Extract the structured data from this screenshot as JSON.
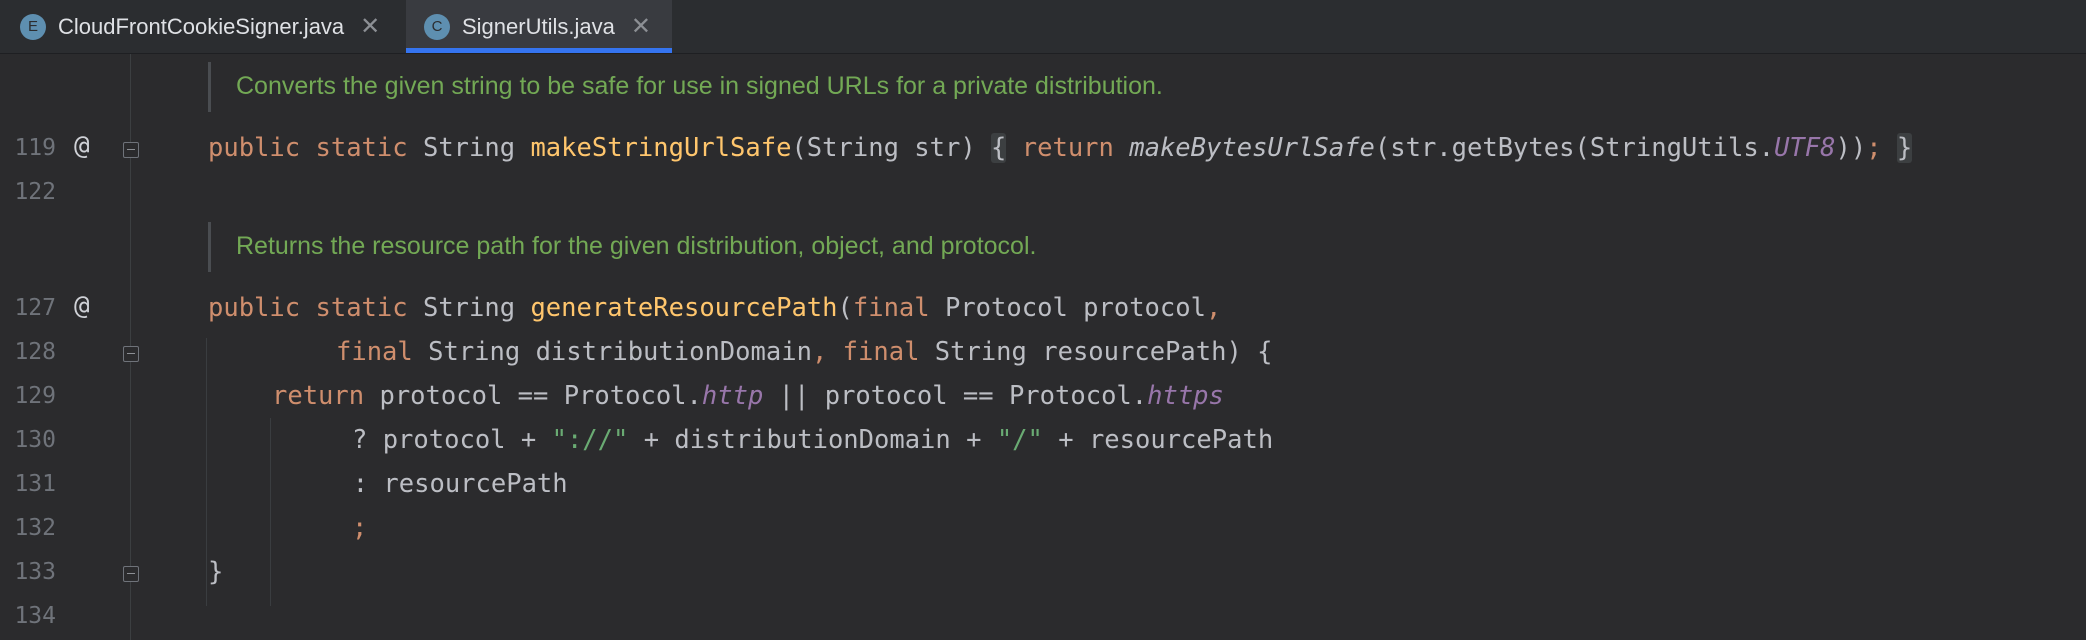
{
  "tabs": [
    {
      "badge": "E",
      "label": "CloudFrontCookieSigner.java",
      "active": false
    },
    {
      "badge": "C",
      "label": "SignerUtils.java",
      "active": true
    }
  ],
  "doc_comments": [
    "Converts the given string to be safe for use in signed URLs for a private distribution.",
    "Returns the resource path for the given distribution, object, and protocol."
  ],
  "line_numbers": {
    "l119": "119",
    "l122": "122",
    "l127": "127",
    "l128": "128",
    "l129": "129",
    "l130": "130",
    "l131": "131",
    "l132": "132",
    "l133": "133",
    "l134": "134"
  },
  "gutter_marker": "@",
  "code": {
    "l119": {
      "public": "public",
      "static": "static",
      "type": "String",
      "name": "makeStringUrlSafe",
      "params": "(String str) ",
      "open": "{",
      "ret": "return",
      "call": "makeBytesUrlSafe",
      "args": "(str.getBytes(StringUtils.",
      "const": "UTF8",
      "close_args": "))",
      "semi": ";",
      "close": "}"
    },
    "l127": {
      "public": "public",
      "static": "static",
      "type": "String",
      "name": "generateResourcePath",
      "paren": "(",
      "final": "final",
      "rest": " Protocol protocol",
      "comma": ","
    },
    "l128": {
      "final1": "final",
      "mid": " String distributionDomain",
      "comma": ",",
      "final2": "final",
      "rest": " String resourcePath) {"
    },
    "l129": {
      "ret": "return",
      "a": " protocol == Protocol.",
      "http": "http",
      "b": " || protocol == Protocol.",
      "https": "https"
    },
    "l130": {
      "a": "? protocol + ",
      "s1": "\"://\"",
      "b": " + distributionDomain + ",
      "s2": "\"/\"",
      "c": " + resourcePath"
    },
    "l131": "  : resourcePath",
    "l132": ";",
    "l133": "}"
  }
}
